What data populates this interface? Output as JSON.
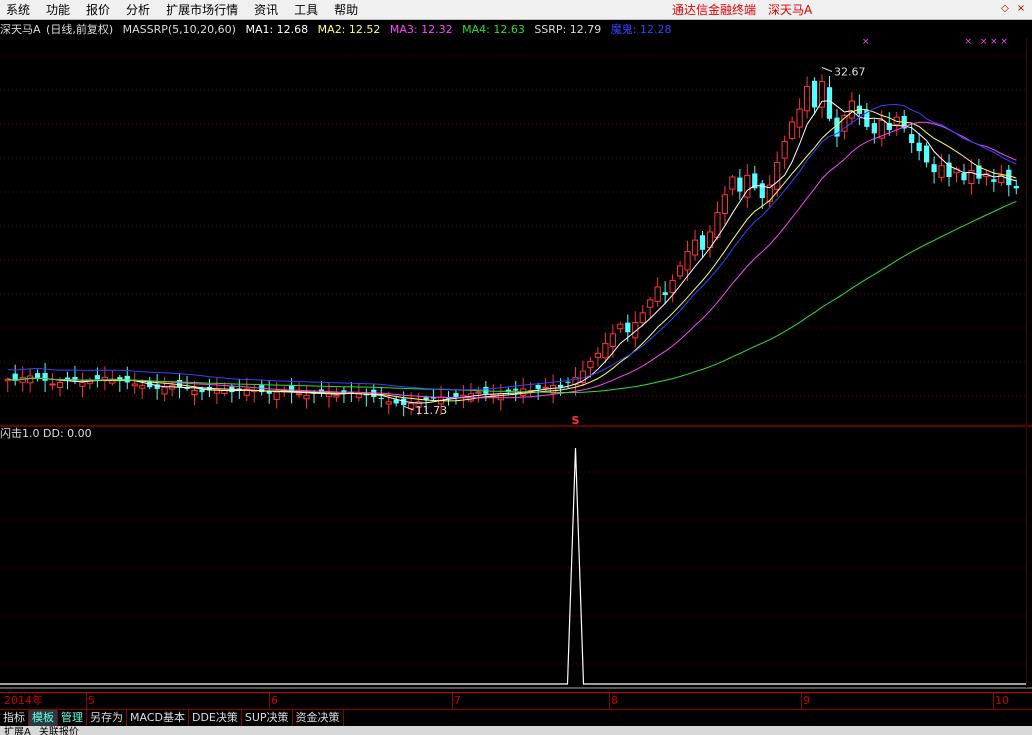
{
  "menu": {
    "items": [
      "系统",
      "功能",
      "报价",
      "分析",
      "扩展市场行情",
      "资讯",
      "工具",
      "帮助"
    ],
    "brand": "通达信金融终端",
    "stock": "深天马A",
    "window_buttons": [
      "◇",
      "×"
    ]
  },
  "indicator_header": {
    "title": "深天马A",
    "period": "(日线,前复权)",
    "formula": "MASSRP(5,10,20,60)",
    "ma1": "MA1: 12.68",
    "ma2": "MA2: 12.52",
    "ma3": "MA3: 12.32",
    "ma4": "MA4: 12.63",
    "ssrp": "SSRP: 12.79",
    "extra": "魔鬼: 12.28"
  },
  "colors": {
    "ma1": "#ffffff",
    "ma2": "#ffff66",
    "ma3": "#ff44ff",
    "ma4": "#33dd33",
    "ssrp": "#3344ff",
    "up": "#ff3333",
    "down": "#55ffff",
    "axis": "#cc0000",
    "grid": "#660000"
  },
  "main_chart": {
    "high_label": "32.67",
    "low_label": "11.73",
    "signal_mark": "S"
  },
  "sub_indicator": {
    "label": "闪击1.0",
    "value": "DD: 0.00"
  },
  "time_axis": {
    "labels": [
      "2014年",
      "5",
      "6",
      "7",
      "8",
      "9",
      "10"
    ]
  },
  "tabs": [
    "指标",
    "模板",
    "管理",
    "另存为",
    "MACD基本",
    "DDE决策",
    "SUP决策",
    "资金决策"
  ],
  "status_tabs": [
    "扩展A",
    "关联报价"
  ],
  "chart_data": {
    "type": "candlestick",
    "x_labels": [
      "2014年",
      "5",
      "6",
      "7",
      "8",
      "9",
      "10"
    ],
    "price_range": [
      11.0,
      34.0
    ],
    "high": 32.67,
    "low": 11.73,
    "ma1_last": 12.68,
    "ma2_last": 12.52,
    "ma3_last": 12.32,
    "ma4_last": 12.63,
    "ssrp_last": 12.79,
    "closes": [
      13.4,
      13.3,
      13.5,
      13.6,
      13.5,
      13.3,
      13.1,
      13.2,
      13.4,
      13.3,
      13.2,
      13.3,
      13.4,
      13.5,
      13.4,
      13.3,
      13.2,
      13.1,
      13.0,
      12.9,
      12.8,
      12.9,
      13.0,
      12.9,
      12.8,
      12.7,
      12.6,
      12.7,
      12.8,
      12.7,
      12.6,
      12.7,
      12.8,
      12.7,
      12.6,
      12.5,
      12.6,
      12.7,
      12.6,
      12.5,
      12.4,
      12.5,
      12.6,
      12.5,
      12.4,
      12.5,
      12.6,
      12.5,
      12.4,
      12.3,
      12.2,
      12.0,
      11.9,
      11.8,
      11.9,
      12.0,
      12.1,
      12.2,
      12.3,
      12.2,
      12.3,
      12.4,
      12.5,
      12.6,
      12.5,
      12.4,
      12.5,
      12.6,
      12.7,
      12.8,
      12.7,
      12.8,
      12.9,
      13.0,
      12.9,
      13.2,
      13.5,
      13.9,
      14.5,
      15.0,
      15.6,
      16.2,
      16.8,
      16.3,
      16.9,
      17.5,
      18.3,
      19.1,
      18.6,
      19.5,
      20.4,
      21.3,
      22.0,
      21.4,
      22.5,
      23.7,
      24.8,
      25.9,
      25.0,
      26.0,
      25.2,
      24.6,
      25.4,
      26.8,
      28.1,
      29.3,
      30.1,
      31.5,
      30.2,
      31.8,
      29.5,
      28.4,
      29.7,
      30.6,
      29.8,
      29.0,
      28.6,
      29.4,
      28.8,
      29.6,
      28.9,
      28.0,
      27.5,
      26.8,
      26.2,
      26.6,
      25.9,
      26.4,
      25.7,
      26.3,
      25.8,
      26.1,
      25.6,
      26.0,
      25.4,
      25.2
    ],
    "subplot": {
      "label": "闪击1.0",
      "series": "DD",
      "last_value": 0.0,
      "spike_index": 76,
      "spike_value": 1.0
    }
  }
}
